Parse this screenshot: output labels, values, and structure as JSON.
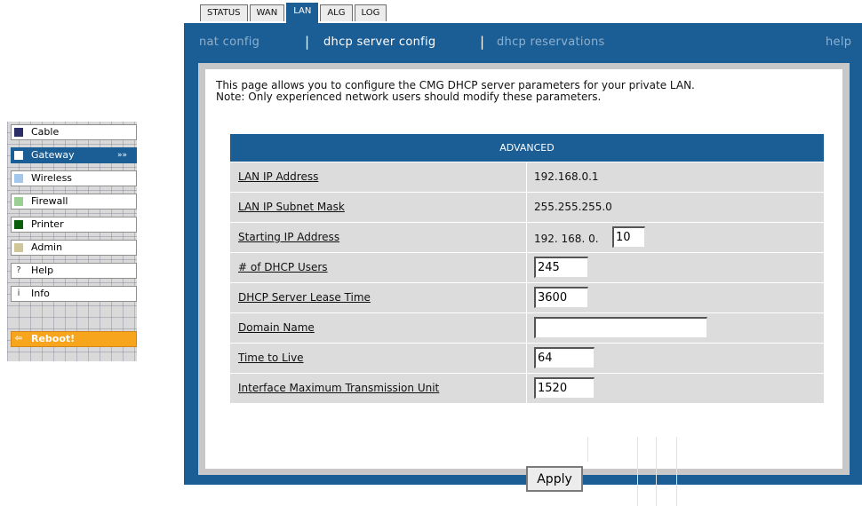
{
  "sidebar": {
    "items": [
      {
        "label": "Cable",
        "icon": "cable-square-icon",
        "color": "#2b2d66"
      },
      {
        "label": "Gateway",
        "icon": "gateway-square-icon",
        "color": "#ffffff",
        "arrow": "»»"
      },
      {
        "label": "Wireless",
        "icon": "wireless-square-icon",
        "color": "#a3c8ec"
      },
      {
        "label": "Firewall",
        "icon": "firewall-square-icon",
        "color": "#9ccf94"
      },
      {
        "label": "Printer",
        "icon": "printer-square-icon",
        "color": "#0b5e0b"
      },
      {
        "label": "Admin",
        "icon": "admin-square-icon",
        "color": "#cfc79a"
      },
      {
        "label": "Help",
        "icon": "question-icon",
        "glyph": "?"
      },
      {
        "label": "Info",
        "icon": "info-icon",
        "glyph": "i"
      }
    ],
    "reboot": {
      "label": "Reboot!",
      "icon": "arrow-left-icon",
      "glyph": "⇦"
    }
  },
  "tabs": [
    "STATUS",
    "WAN",
    "LAN",
    "ALG",
    "LOG"
  ],
  "active_tab": "LAN",
  "subnav": {
    "items": [
      "nat config",
      "dhcp server config",
      "dhcp reservations"
    ],
    "active": "dhcp server config",
    "help": "help"
  },
  "intro": {
    "line1": "This page allows you to configure the CMG DHCP server parameters for your private LAN.",
    "line2": "Note: Only experienced network users should modify these parameters."
  },
  "advanced": {
    "title": "ADVANCED",
    "lan_ip_label": "LAN IP Address",
    "lan_ip_value": "192.168.0.1",
    "mask_label": "LAN IP Subnet Mask",
    "mask_value": "255.255.255.0",
    "start_label": "Starting IP Address",
    "start_prefix": "192. 168. 0.",
    "start_last_octet": "10",
    "users_label": "# of DHCP Users",
    "users_value": "245",
    "lease_label": "DHCP Server Lease Time",
    "lease_value": "3600",
    "domain_label": "Domain Name",
    "domain_value": "",
    "ttl_label": "Time to Live",
    "ttl_value": "64",
    "mtu_label": "Interface Maximum Transmission Unit",
    "mtu_value": "1520"
  },
  "apply_label": "Apply",
  "colors": {
    "accent": "#1b5e96",
    "reboot": "#f7a51d",
    "panel_gray": "#c8c8c8"
  }
}
